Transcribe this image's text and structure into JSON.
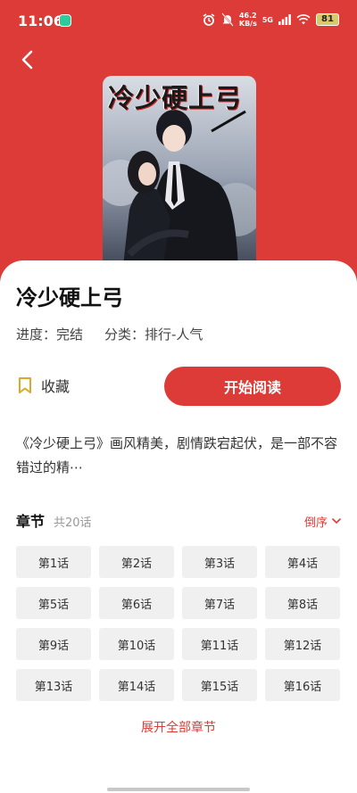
{
  "status": {
    "time": "11:06",
    "net_speed": "46.2",
    "net_unit": "KB/s",
    "signal": "5G",
    "battery": "81"
  },
  "book": {
    "cover_title": "冷少硬上弓",
    "title": "冷少硬上弓",
    "progress": "进度：完结",
    "category": "分类：排行-人气",
    "description": "《冷少硬上弓》画风精美，剧情跌宕起伏，是一部不容错过的精⋯"
  },
  "actions": {
    "collect_label": "收藏",
    "read_label": "开始阅读"
  },
  "chapters": {
    "title": "章节",
    "count": "共20话",
    "sort_label": "倒序",
    "items": [
      "第1话",
      "第2话",
      "第3话",
      "第4话",
      "第5话",
      "第6话",
      "第7话",
      "第8话",
      "第9话",
      "第10话",
      "第11话",
      "第12话",
      "第13话",
      "第14话",
      "第15话",
      "第16话"
    ],
    "expand_label": "展开全部章节"
  },
  "colors": {
    "accent": "#dc3b37",
    "card_bg": "#ffffff",
    "chapter_bg": "#f0f0f0"
  },
  "icons": [
    "back-arrow-icon",
    "bookmark-icon",
    "chevron-down-icon",
    "alarm-icon",
    "mute-icon",
    "signal-icon",
    "wifi-icon",
    "battery-icon"
  ]
}
